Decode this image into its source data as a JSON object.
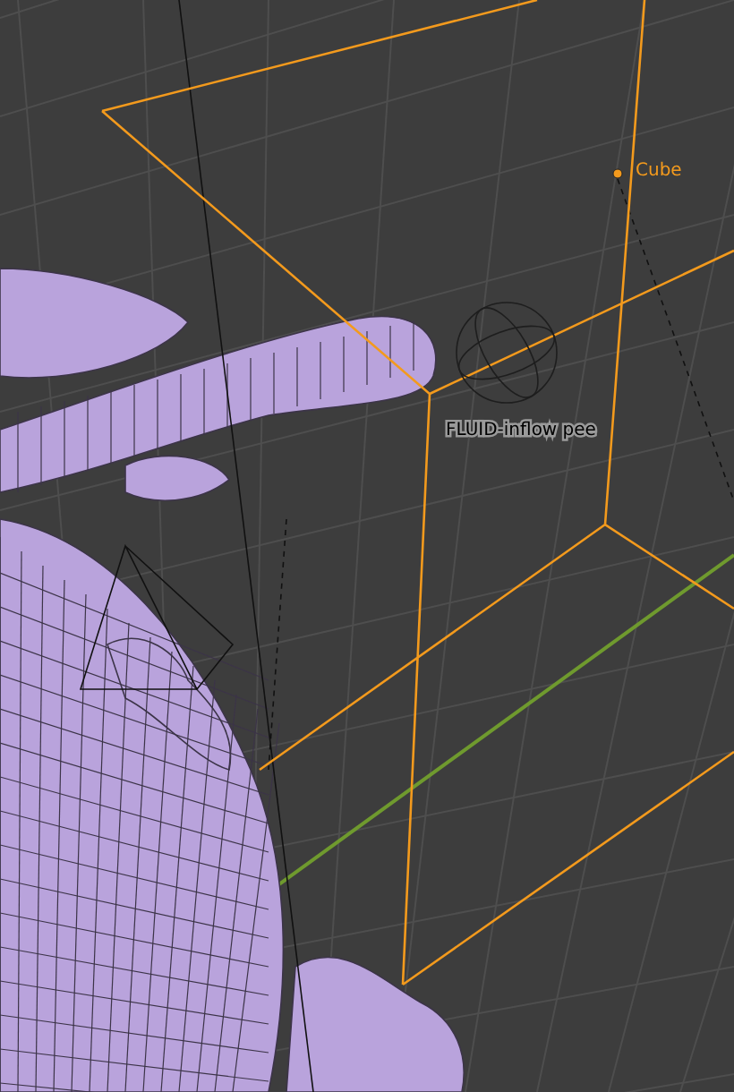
{
  "viewport": {
    "objects": [
      {
        "kind": "cube",
        "label": "Cube",
        "selected": true
      },
      {
        "kind": "empty",
        "label": "FLUID-inflow pee",
        "selected": false
      }
    ]
  }
}
